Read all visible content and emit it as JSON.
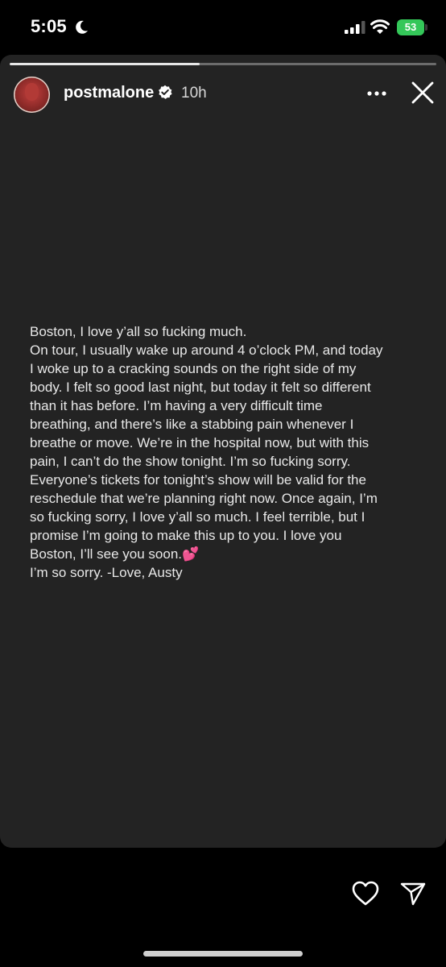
{
  "status_bar": {
    "time": "5:05",
    "battery_level": "53"
  },
  "story": {
    "progress_fraction": 0.445,
    "username": "postmalone",
    "time_ago": "10h",
    "text_lines": [
      "Boston, I love y’all so fucking much.",
      "On tour, I usually wake up around 4 o’clock PM, and today",
      "I woke up to a cracking sounds on the right side of my",
      "body. I felt so good last night, but today it felt so different",
      "than it has before. I’m having a very difficult time",
      "breathing, and there’s like a stabbing pain whenever I",
      "breathe or move. We’re in the hospital now, but with this",
      "pain, I can’t do the show tonight. I’m so fucking sorry.",
      "Everyone’s tickets for tonight’s show will be valid for the",
      "reschedule that we’re planning right now. Once again, I’m",
      "so fucking sorry, I love y’all so much. I feel terrible, but I",
      "promise I’m going to make this up to you. I love you",
      "Boston, I’ll see you soon.💕",
      "I’m so sorry. -Love, Austy"
    ]
  },
  "icons": {
    "moon": "moon-icon",
    "signal": "cellular-signal-icon",
    "wifi": "wifi-icon",
    "verified": "verified-badge-icon",
    "more": "more-options-icon",
    "close": "close-icon",
    "like": "heart-icon",
    "share": "send-icon"
  },
  "colors": {
    "battery": "#34c759",
    "card_background": "#232323",
    "verified_badge": "#ffffff"
  }
}
